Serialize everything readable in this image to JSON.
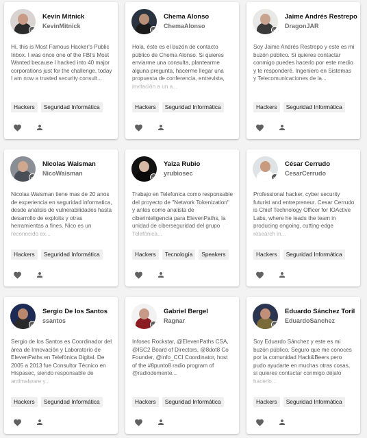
{
  "colors": {
    "verified": "#5b5b5b",
    "icon": "#616161",
    "tag_bg": "#efefef",
    "card_bg": "#ffffff",
    "page_bg": "#f3f3f3"
  },
  "icons": {
    "verified": "check-badge-icon",
    "like": "heart-icon",
    "follow": "person-icon"
  },
  "profiles": [
    {
      "name": "Kevin Mitnick",
      "handle": "KevinMitnick",
      "bio": "Hi, this is Most Famous Hacker's Public Inbox. I was once one of the FBI's Most Wanted because I hacked into 40 major corporations just for the challenge, today I am now a trusted security consult...",
      "tags": [
        "Hackers",
        "Seguridad Informática"
      ],
      "avatar": {
        "bg": "#d9d3d2",
        "skin": "#c99a86",
        "shirt": "#2b2b2b"
      }
    },
    {
      "name": "Chema Alonso",
      "handle": "ChemaAlonso",
      "bio": "Hola, éste es el buzón de contacto público de Chema Alonso. Si quieres enviarme una consulta, plantearme alguna pregunta, hacerme llegar una propuesta de conferencia, entrevista, invitación a un a...",
      "tags": [
        "Hackers",
        "Seguridad Informática"
      ],
      "avatar": {
        "bg": "#2a3340",
        "skin": "#b89077",
        "shirt": "#1b1b1b"
      }
    },
    {
      "name": "Jaime Andrés Restrepo",
      "handle": "DragonJAR",
      "bio": "Soy Jaime Andrés Restrepo y este es mi buzón público. Si quieres contactar conmigo puedes hacerlo por este medio y te responderé. Ingeniero en Sistemas y Telecomunicaciones de la...",
      "tags": [
        "Hackers",
        "Seguridad Informática"
      ],
      "avatar": {
        "bg": "#e8e8e6",
        "skin": "#c8a48e",
        "shirt": "#3a3a3a"
      }
    },
    {
      "name": "Nicolas Waisman",
      "handle": "NicoWaisman",
      "bio": "Nicolas Waisman tiene mas de 20 anos de experiencia en seguridad informatica, desde análisis de vulnerabilidades hasta desarrollo de exploits y otras herramientas a fines. Nico es un reconocido ex...",
      "tags": [
        "Hackers",
        "Seguridad Informática"
      ],
      "avatar": {
        "bg": "#8a8f96",
        "skin": "#cfa88f",
        "shirt": "#4a4f57"
      }
    },
    {
      "name": "Yaiza Rubio",
      "handle": "yrubiosec",
      "bio": "Trabajo en Telefonica como responsable del proyecto de \"Network Tokenization\" y antes como analista de ciberinteligencia para ElevenPaths, la unidad de ciberseguridad del grupo Telefónica...",
      "tags": [
        "Hackers",
        "Tecnología",
        "Speakers"
      ],
      "avatar": {
        "bg": "#121212",
        "skin": "#d6b9a6",
        "shirt": "#0a0a0a"
      }
    },
    {
      "name": "César Cerrudo",
      "handle": "CesarCerrudo",
      "bio": "Professional hacker, cyber security futurist and entrepreneur. Cesar Cerrudo is Chief Technology Officer for IOActive Labs, where he leads the team in producing ongoing, cutting-edge research in...",
      "tags": [
        "Hackers",
        "Seguridad Informática"
      ],
      "avatar": {
        "bg": "#dfe3e6",
        "skin": "#c89a7e",
        "shirt": "#ffffff"
      }
    },
    {
      "name": "Sergio De los Santos",
      "handle": "ssantos",
      "bio": "Sergio de los Santos es Coordinador del área de Innovación y Laboratorio de ElevenPaths en Telefónica Digital. De 2005 a 2013 fue Consultor Técnico en Hispasec, siendo responsable de antimalware y...",
      "tags": [
        "Hackers",
        "Seguridad Informática"
      ],
      "avatar": {
        "bg": "#1c2a55",
        "skin": "#b8876e",
        "shirt": "#2a2a2a"
      }
    },
    {
      "name": "Gabriel Bergel",
      "handle": "Ragnar",
      "bio": "Infosec Rockstar, @ElevenPaths CSA, @ISC2 Board of Directors, @8dot8 Co Founder, @info_CCI Coordinator, host of the #8punto8 radio program of @radiodemente...",
      "tags": [
        "Hackers",
        "Seguridad Informática"
      ],
      "avatar": {
        "bg": "#f2f2f2",
        "skin": "#c69a86",
        "shirt": "#8b1d22"
      }
    },
    {
      "name": "Eduardo Sánchez Toril",
      "handle": "EduardoSanchez",
      "bio": "Soy Eduardo Sánchez y este es mi buzón público. Seguro que me conoces por la comunidad Hack&Beers pero pudo ayudarte en muchas otras cosas, si quieres contactar conmigo déjalo hacerlo...",
      "tags": [
        "Hackers",
        "Seguridad Informática"
      ],
      "avatar": {
        "bg": "#2b3550",
        "skin": "#c29079",
        "shirt": "#7a6a3a"
      }
    }
  ]
}
